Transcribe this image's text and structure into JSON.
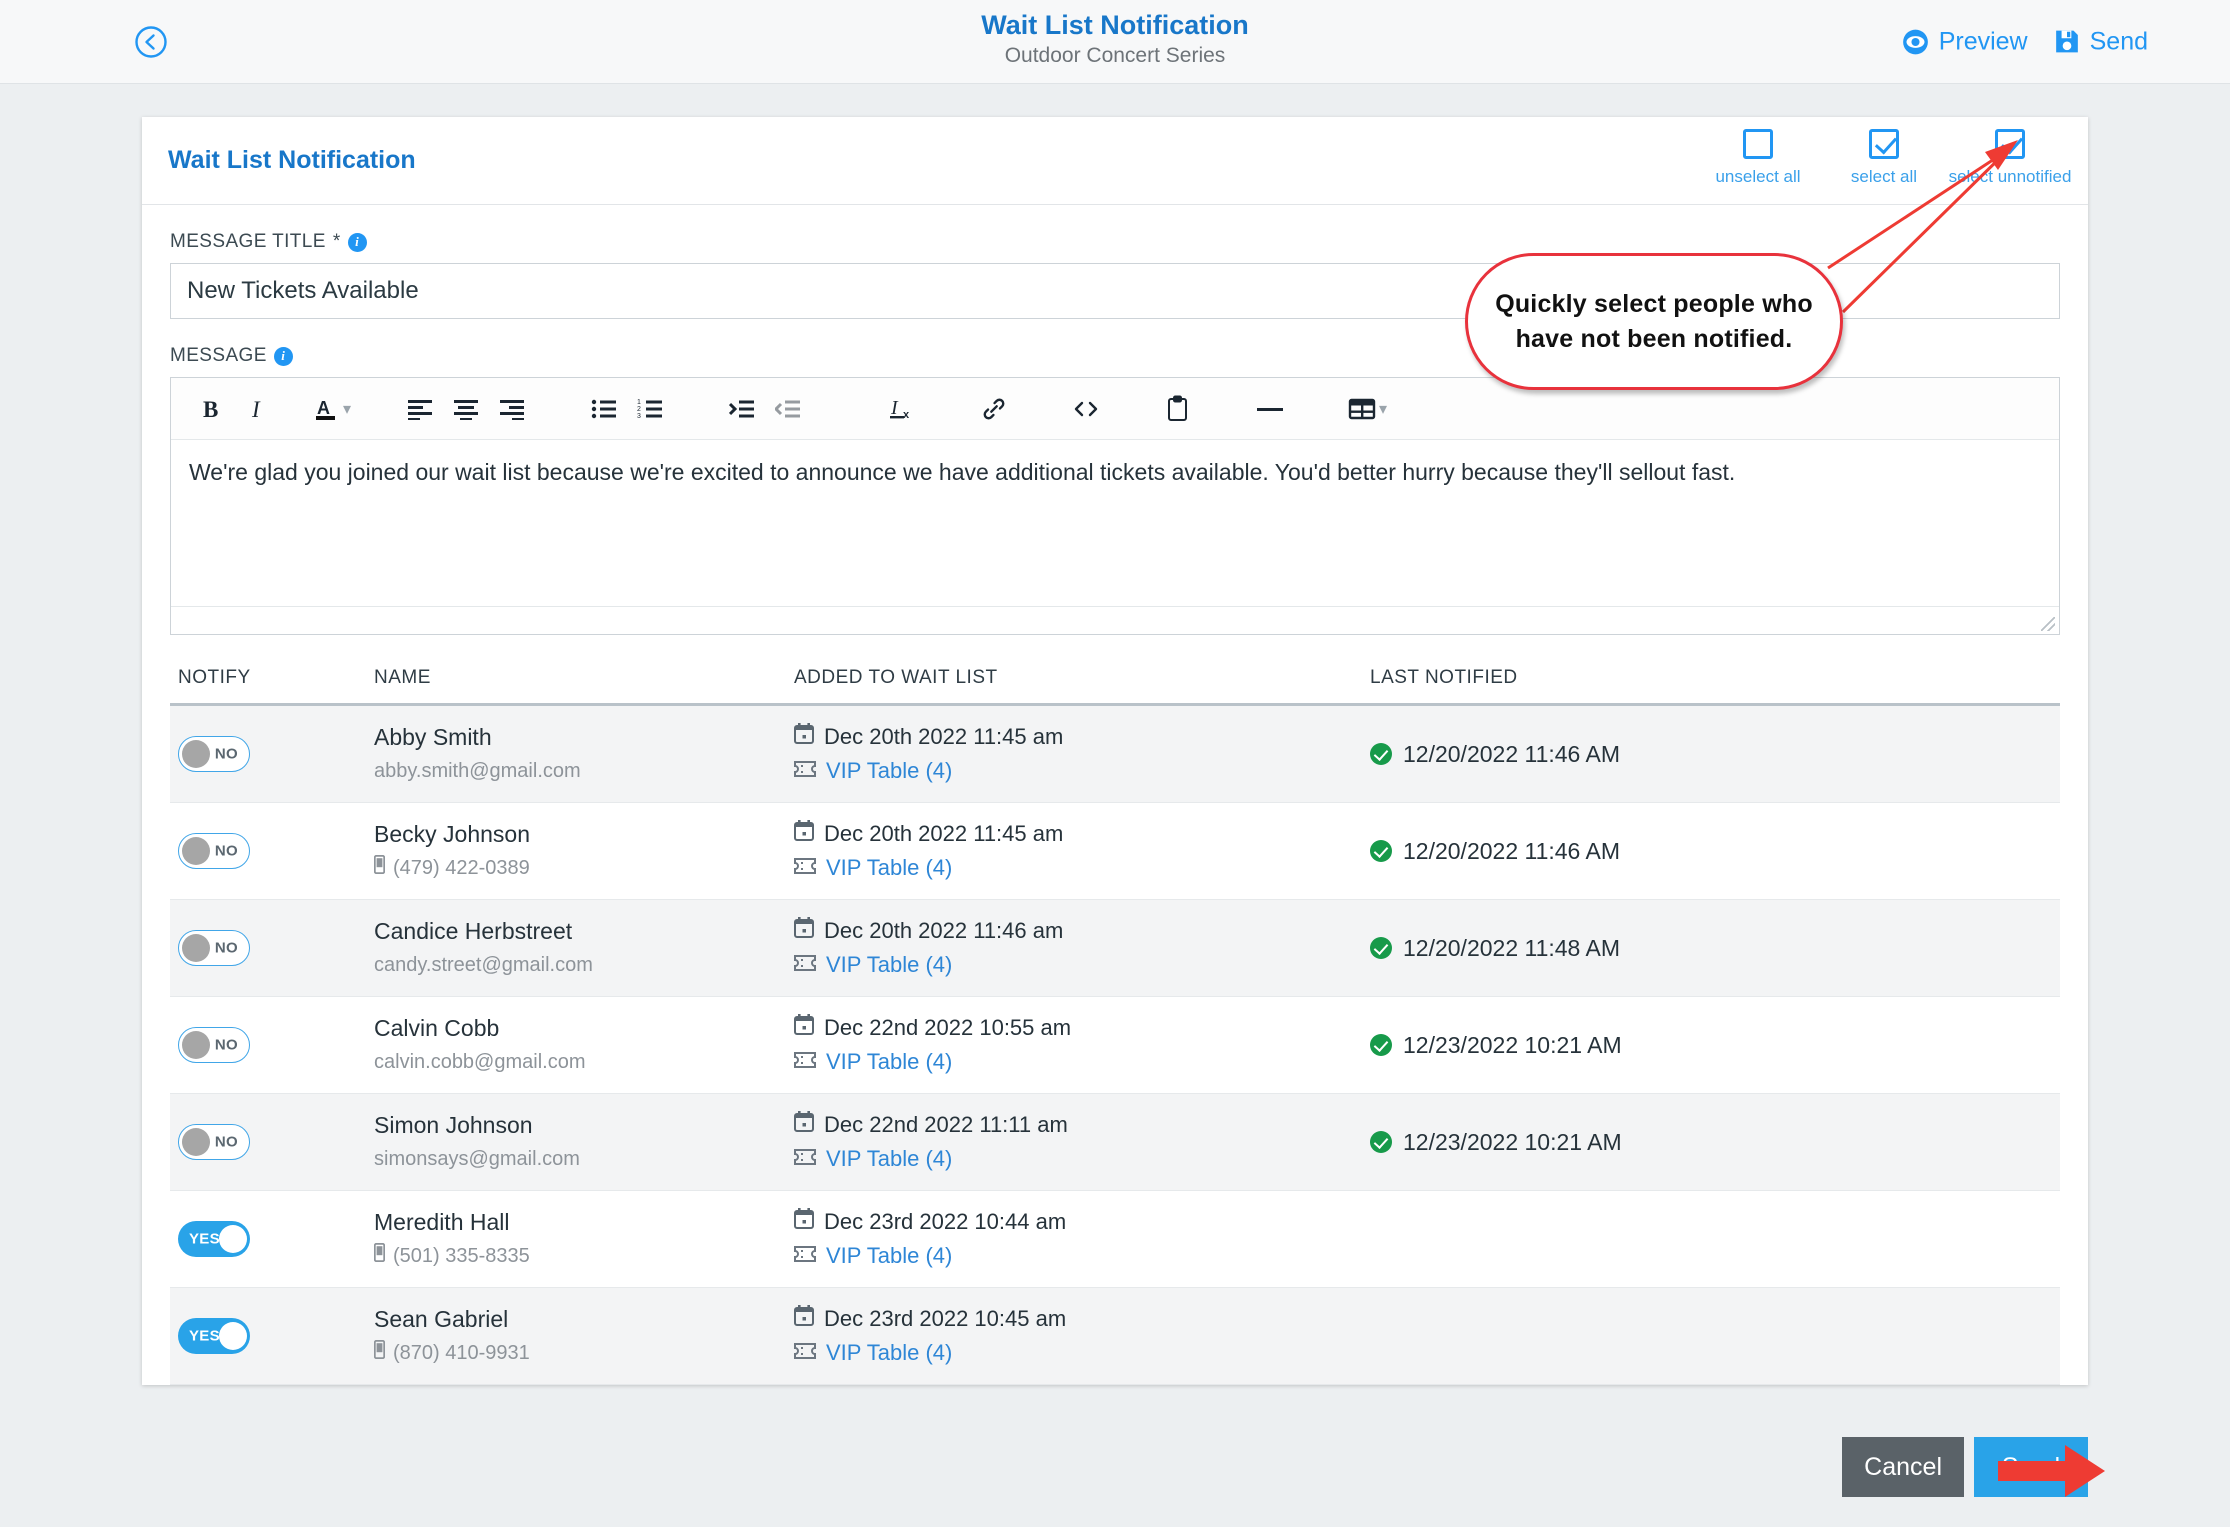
{
  "topbar": {
    "back_icon": "circle-chevron-left-icon",
    "title": "Wait List Notification",
    "subtitle": "Outdoor Concert Series",
    "preview_label": "Preview",
    "send_label": "Send",
    "preview_icon": "eye-icon",
    "send_icon": "save-disk-icon"
  },
  "card": {
    "title": "Wait List Notification",
    "select_tools": [
      {
        "label": "unselect all",
        "checked": false,
        "icon": "checkbox-empty-icon"
      },
      {
        "label": "select all",
        "checked": true,
        "icon": "checkbox-checked-icon"
      },
      {
        "label": "select unnotified",
        "checked": true,
        "icon": "checkbox-checked-icon"
      }
    ]
  },
  "form": {
    "title_label": "MESSAGE TITLE",
    "title_required": "*",
    "title_value": "New Tickets Available",
    "title_placeholder": "",
    "message_label": "MESSAGE",
    "message_body": "We're glad you joined our wait list because we're excited to announce we have additional tickets available. You'd better hurry because they'll sellout fast."
  },
  "toolbar_buttons": [
    {
      "name": "bold-icon",
      "glyph": "B"
    },
    {
      "name": "italic-icon",
      "glyph": "I"
    },
    {
      "name": "font-color-icon",
      "glyph": "A"
    },
    {
      "name": "chevron-down-icon",
      "glyph": "∨"
    },
    {
      "name": "align-left-icon",
      "glyph": ""
    },
    {
      "name": "align-center-icon",
      "glyph": ""
    },
    {
      "name": "align-right-icon",
      "glyph": ""
    },
    {
      "name": "bulleted-list-icon",
      "glyph": ""
    },
    {
      "name": "numbered-list-icon",
      "glyph": ""
    },
    {
      "name": "indent-icon",
      "glyph": ""
    },
    {
      "name": "outdent-icon",
      "glyph": ""
    },
    {
      "name": "clear-formatting-icon",
      "glyph": ""
    },
    {
      "name": "link-icon",
      "glyph": ""
    },
    {
      "name": "source-code-icon",
      "glyph": "<>"
    },
    {
      "name": "paste-clipboard-icon",
      "glyph": ""
    },
    {
      "name": "horizontal-rule-icon",
      "glyph": ""
    },
    {
      "name": "table-icon",
      "glyph": ""
    },
    {
      "name": "chevron-down-icon",
      "glyph": "∨"
    }
  ],
  "table": {
    "headers": {
      "notify": "NOTIFY",
      "name": "NAME",
      "added": "ADDED TO WAIT LIST",
      "last_notified": "LAST NOTIFIED"
    },
    "rows": [
      {
        "notify": "NO",
        "notify_on": false,
        "name": "Abby Smith",
        "contact": "abby.smith@gmail.com",
        "contact_type": "email",
        "added_date": "Dec 20th 2022 11:45 am",
        "table_link": "VIP Table (4)",
        "last_notified": "12/20/2022 11:46 AM"
      },
      {
        "notify": "NO",
        "notify_on": false,
        "name": "Becky Johnson",
        "contact": "(479) 422-0389",
        "contact_type": "phone",
        "added_date": "Dec 20th 2022 11:45 am",
        "table_link": "VIP Table (4)",
        "last_notified": "12/20/2022 11:46 AM"
      },
      {
        "notify": "NO",
        "notify_on": false,
        "name": "Candice Herbstreet",
        "contact": "candy.street@gmail.com",
        "contact_type": "email",
        "added_date": "Dec 20th 2022 11:46 am",
        "table_link": "VIP Table (4)",
        "last_notified": "12/20/2022 11:48 AM"
      },
      {
        "notify": "NO",
        "notify_on": false,
        "name": "Calvin Cobb",
        "contact": "calvin.cobb@gmail.com",
        "contact_type": "email",
        "added_date": "Dec 22nd 2022 10:55 am",
        "table_link": "VIP Table (4)",
        "last_notified": "12/23/2022 10:21 AM"
      },
      {
        "notify": "NO",
        "notify_on": false,
        "name": "Simon Johnson",
        "contact": "simonsays@gmail.com",
        "contact_type": "email",
        "added_date": "Dec 22nd 2022 11:11 am",
        "table_link": "VIP Table (4)",
        "last_notified": "12/23/2022 10:21 AM"
      },
      {
        "notify": "YES",
        "notify_on": true,
        "name": "Meredith Hall",
        "contact": "(501) 335-8335",
        "contact_type": "phone",
        "added_date": "Dec 23rd 2022 10:44 am",
        "table_link": "VIP Table (4)",
        "last_notified": ""
      },
      {
        "notify": "YES",
        "notify_on": true,
        "name": "Sean Gabriel",
        "contact": "(870) 410-9931",
        "contact_type": "phone",
        "added_date": "Dec 23rd 2022 10:45 am",
        "table_link": "VIP Table (4)",
        "last_notified": ""
      }
    ]
  },
  "footer": {
    "cancel_label": "Cancel",
    "send_label": "Send"
  },
  "annotations": {
    "callout_text": "Quickly select people who have not been notified.",
    "callout_color": "#e8323c",
    "arrow_color": "#ee3b33"
  }
}
